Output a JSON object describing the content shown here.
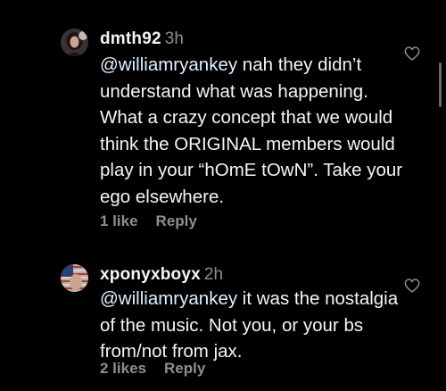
{
  "comments": [
    {
      "username": "dmth92",
      "time": "3h",
      "mention": "@williamryankey",
      "text": " nah they didn’t understand what was happening. What a crazy concept that we would think the ORIGINAL members would play in your “hOmE tOwN”. Take your ego elsewhere.",
      "likes": "1 like",
      "reply": "Reply",
      "icons": {
        "avatar": "avatar-photo",
        "like": "heart-icon"
      }
    },
    {
      "username": "xponyxboyx",
      "time": "2h",
      "mention": "@williamryankey",
      "text": " it was the nostalgia of the music. Not you, or your bs from/not from jax.",
      "likes": "2 likes",
      "reply": "Reply",
      "icons": {
        "avatar": "avatar-flag",
        "like": "heart-icon"
      }
    }
  ],
  "colors": {
    "background": "#000000",
    "text": "#f5f5f5",
    "secondary": "#8e8e8e",
    "mention": "#e0f1ff"
  }
}
